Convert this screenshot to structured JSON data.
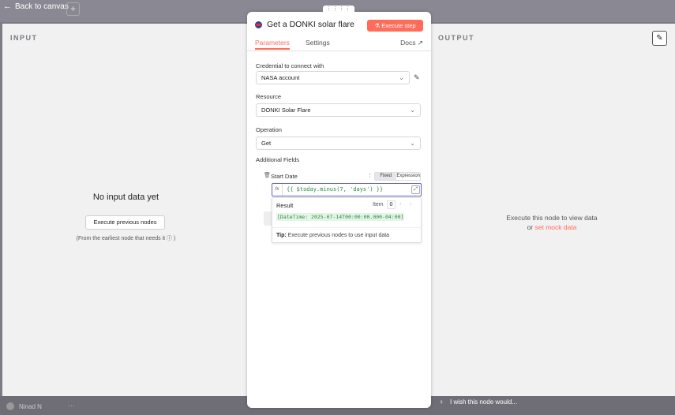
{
  "canvas": {
    "back_label": "Back to canvas",
    "plus_label": "+",
    "user_name": "Ninad N",
    "dots": "···",
    "wish_text": "I wish this node would..."
  },
  "input_panel": {
    "title": "INPUT",
    "empty_title": "No input data yet",
    "execute_prev_label": "Execute previous nodes",
    "hint": "(From the earliest node that needs it ⓘ )"
  },
  "output_panel": {
    "title": "OUTPUT",
    "message_line1": "Execute this node to view data",
    "message_or": "or ",
    "mock_link": "set mock data"
  },
  "node": {
    "drag_handle": "⋮⋮⋮⋮",
    "title": "Get a DONKI solar flare",
    "execute_step_label": "Execute step",
    "tabs": {
      "parameters": "Parameters",
      "settings": "Settings",
      "docs": "Docs ↗"
    },
    "credential": {
      "label": "Credential to connect with",
      "value": "NASA account"
    },
    "resource": {
      "label": "Resource",
      "value": "DONKI Solar Flare"
    },
    "operation": {
      "label": "Operation",
      "value": "Get"
    },
    "additional_fields_label": "Additional Fields",
    "start_date": {
      "label": "Start Date",
      "toggle_fixed": "Fixed",
      "toggle_expression": "Expression",
      "fx": "fx",
      "expression": "{{ $today.minus(7, 'days') }}"
    },
    "result": {
      "label": "Result",
      "item_label": "Item",
      "item_value": "0",
      "value": "[DateTime: 2025-07-14T00:00:00.000-04:00]",
      "tip_bold": "Tip:",
      "tip_text": " Execute previous nodes to use input data"
    }
  },
  "colors": {
    "accent": "#ff6d5a",
    "expression_green": "#2a8a3a",
    "focus_border": "#5a5fd8"
  }
}
